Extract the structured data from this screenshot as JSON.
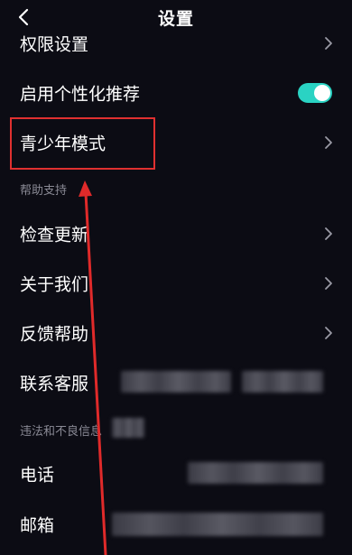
{
  "header": {
    "title": "设置",
    "back_icon": "chevron-left-icon"
  },
  "rows": {
    "permissions": {
      "label": "权限设置"
    },
    "personalized": {
      "label": "启用个性化推荐",
      "toggle_on": true
    },
    "youth_mode": {
      "label": "青少年模式"
    },
    "check_update": {
      "label": "检查更新"
    },
    "about": {
      "label": "关于我们"
    },
    "feedback": {
      "label": "反馈帮助"
    },
    "contact": {
      "label": "联系客服"
    },
    "phone": {
      "label": "电话"
    },
    "email": {
      "label": "邮箱"
    }
  },
  "sections": {
    "help": "帮助支持",
    "report": "违法和不良信息"
  },
  "colors": {
    "background": "#0c0c14",
    "toggle_on": "#2ad3c3",
    "highlight": "#e03030",
    "section_text": "#8a8a95",
    "chevron": "#9a9aa5"
  }
}
